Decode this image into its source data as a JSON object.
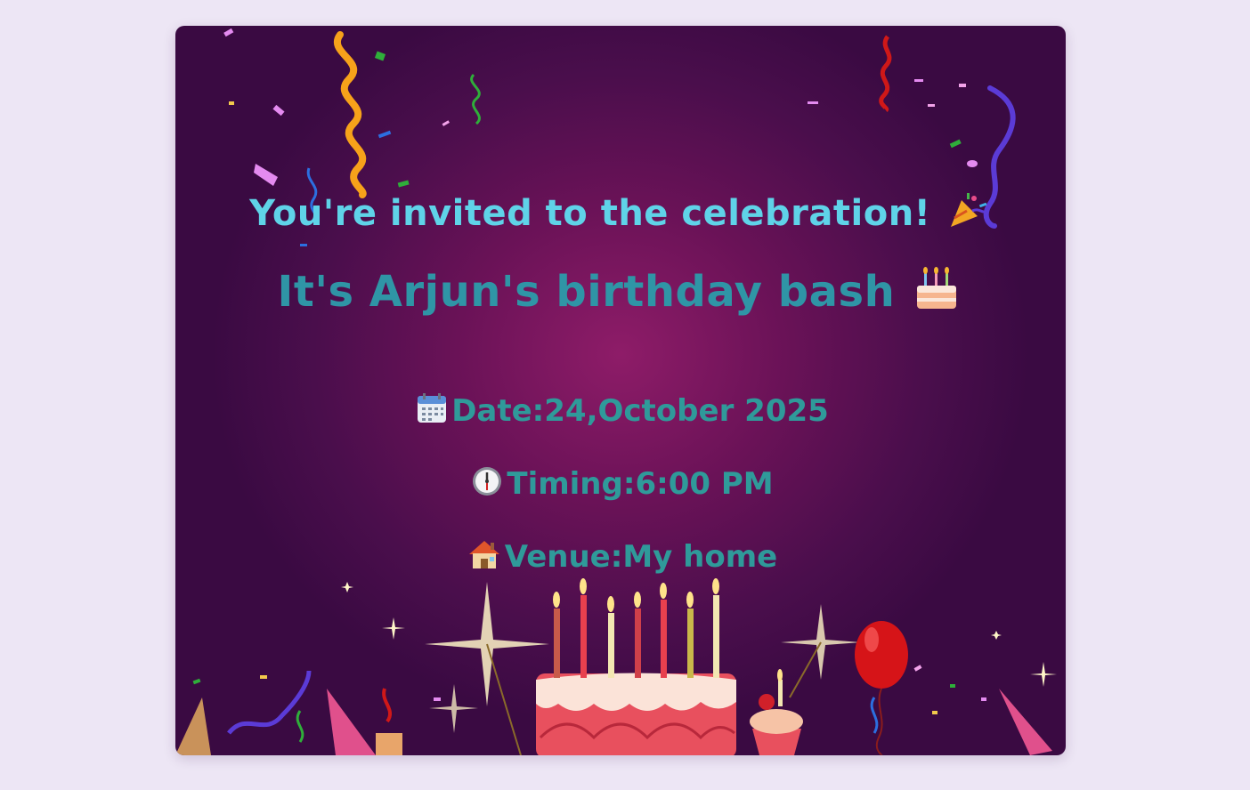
{
  "invite_line": "You're invited to the celebration!",
  "headline": "It's Arjun's birthday bash",
  "details": {
    "date_label": "Date:",
    "date_value": "24,October 2025",
    "time_label": "Timing:",
    "time_value": "6:00 PM",
    "venue_label": "Venue:",
    "venue_value": "My home"
  },
  "icons": {
    "invite": "party-popper-icon",
    "headline": "birthday-cake-icon",
    "date": "calendar-icon",
    "time": "clock-icon",
    "venue": "house-icon"
  },
  "colors": {
    "page_bg": "#ede6f5",
    "card_center": "#8e1c68",
    "card_edge": "#3a0a42",
    "invite_text": "#5fd3e8",
    "headline_text": "#2f95a6",
    "details_text": "#2f9a9a"
  }
}
